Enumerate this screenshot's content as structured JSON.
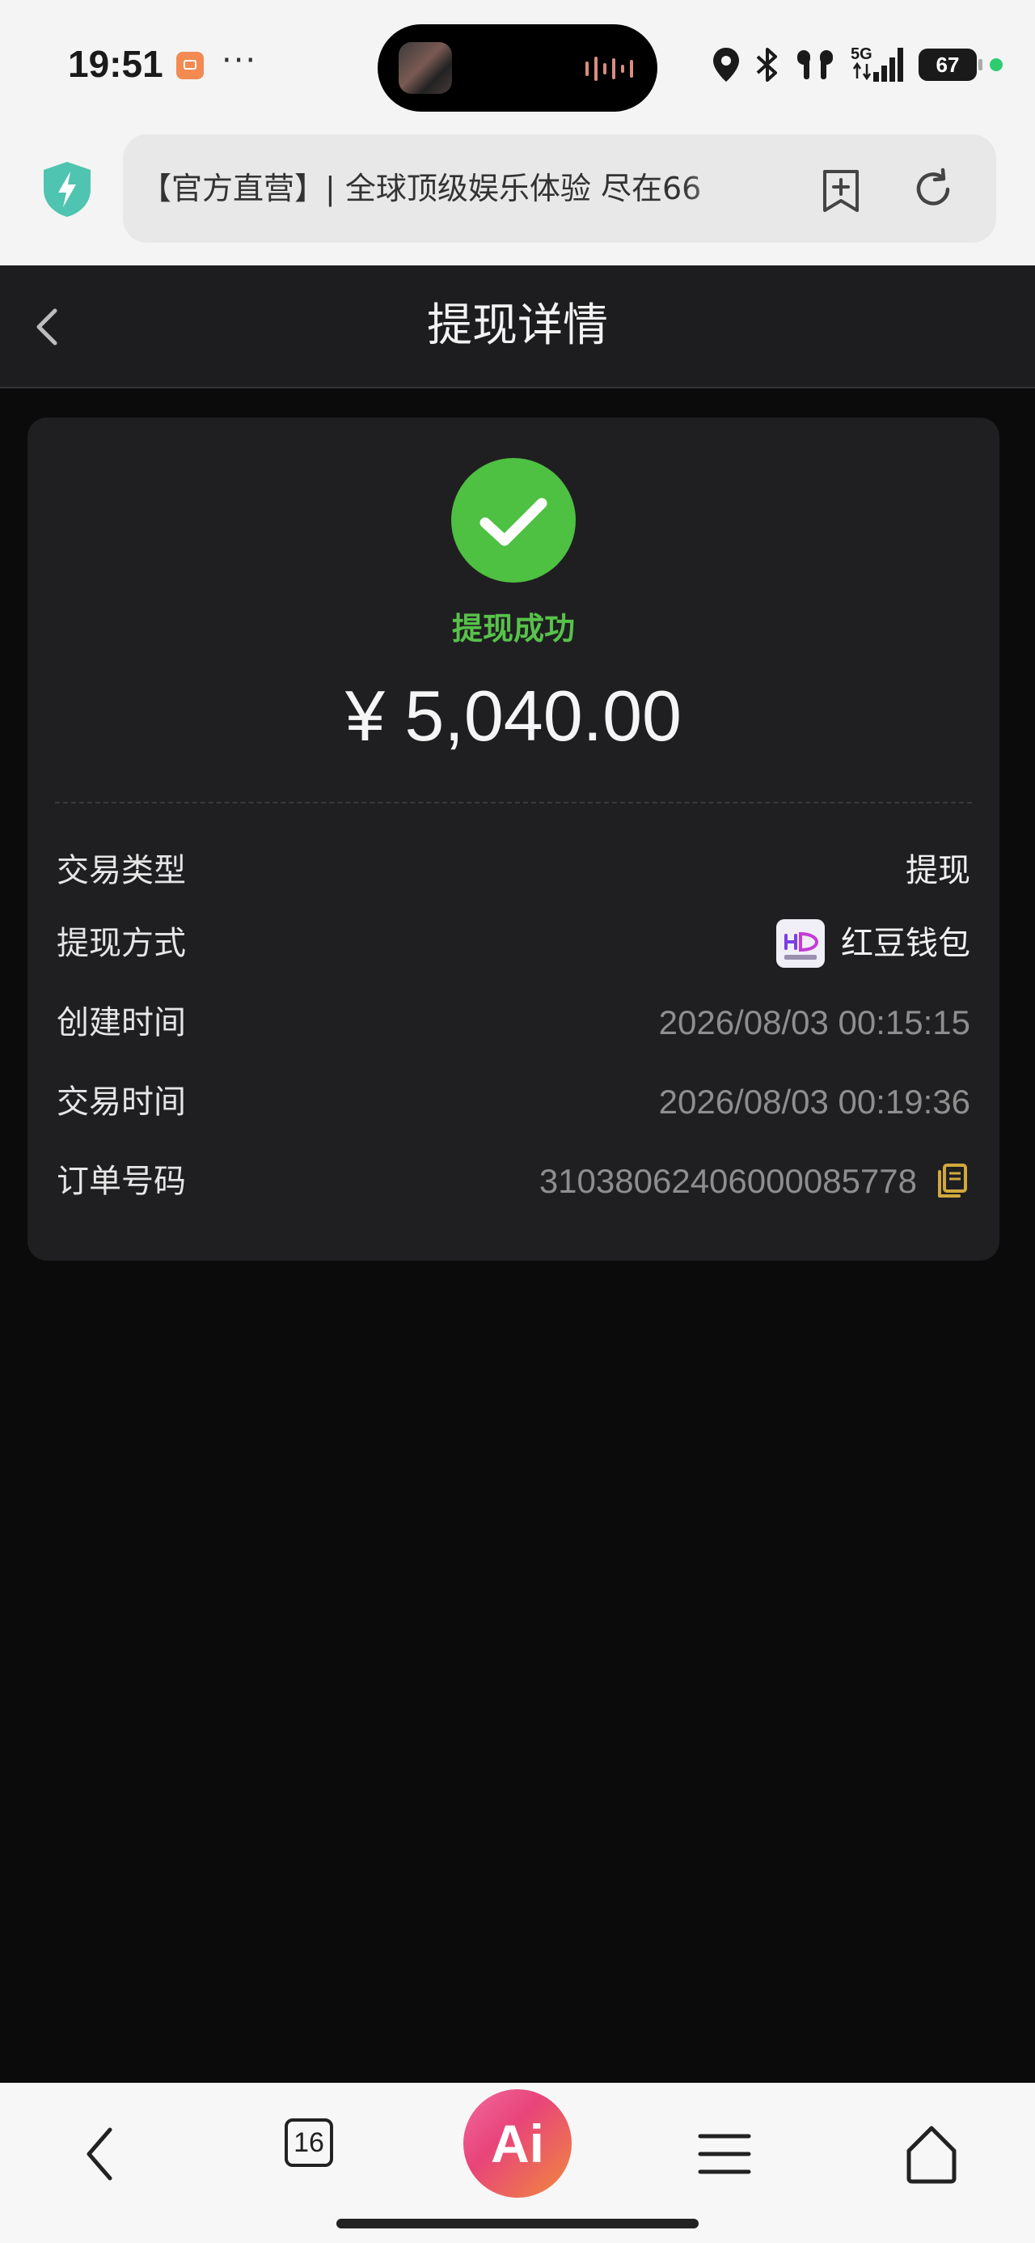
{
  "status_bar": {
    "time": "19:51",
    "more": "···",
    "network": "5G",
    "battery": "67"
  },
  "browser": {
    "url_title": "【官方直营】| 全球顶级娱乐体验 尽在66",
    "tab_count": "16",
    "ai_label": "Ai"
  },
  "header": {
    "title": "提现详情"
  },
  "result": {
    "status": "提现成功",
    "amount": "¥ 5,040.00",
    "status_color": "#57c24a"
  },
  "details": [
    {
      "label": "交易类型",
      "value": "提现"
    },
    {
      "label": "提现方式",
      "value": "红豆钱包"
    },
    {
      "label": "创建时间",
      "value": "2026/08/03 00:15:15"
    },
    {
      "label": "交易时间",
      "value": "2026/08/03 00:19:36"
    },
    {
      "label": "订单号码",
      "value": "31038062406000085778"
    }
  ],
  "icons": {
    "shield": "shield-icon",
    "bookmark": "bookmark-add-icon",
    "reload": "reload-icon",
    "back": "back-icon",
    "check": "check-icon",
    "wallet": "wallet-logo-icon",
    "copy": "copy-icon"
  }
}
